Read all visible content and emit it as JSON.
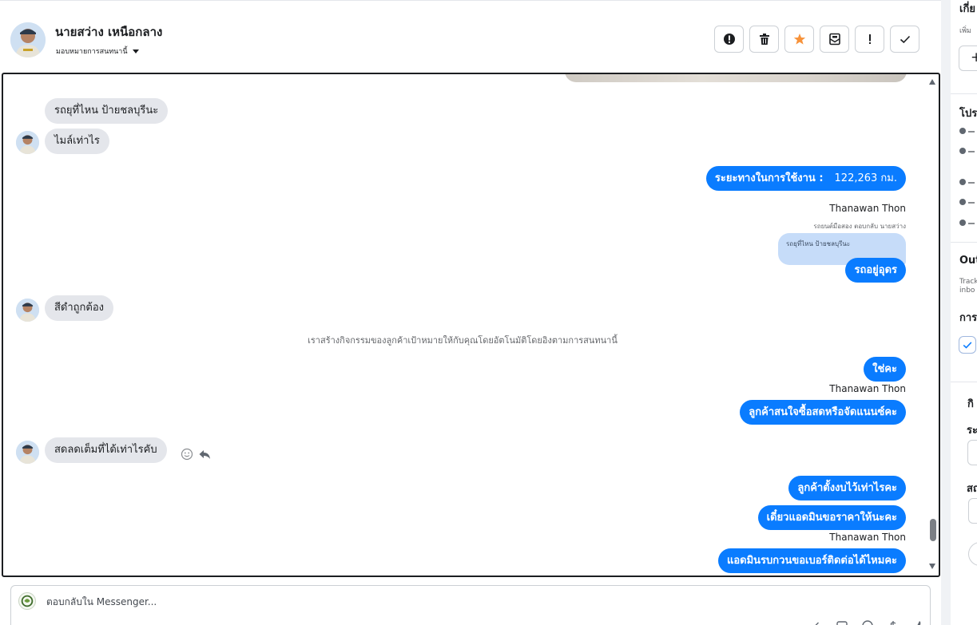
{
  "header": {
    "contact_name": "นายสว่าง เหนือกลาง",
    "assign_label": "มอบหมายการสนทนานี้",
    "tool_icons": [
      "alert-circle-icon",
      "trash-icon",
      "star-icon",
      "mark-unread-icon",
      "exclamation-icon",
      "check-icon"
    ],
    "star_color": "#f7923a"
  },
  "chat": {
    "messages": [
      {
        "dir": "in",
        "text": "รถยุที่ไหน ป้ายชลบุรีนะ"
      },
      {
        "dir": "in",
        "text": "ไมล์เท่าไร"
      },
      {
        "dir": "out",
        "text": "ระยะทางในการใช้งาน :",
        "value": "122,263 กม."
      },
      {
        "dir": "out_sender",
        "text": "Thanawan Thon"
      },
      {
        "dir": "reply_hint",
        "text": "รถยนต์มือสอง ตอบกลับ นายสว่าง"
      },
      {
        "dir": "quoted",
        "text": "รถยุที่ไหน ป้ายชลบุรีนะ"
      },
      {
        "dir": "out",
        "text": "รถอยู่อุดร"
      },
      {
        "dir": "in",
        "text": "สีดำถูกต้อง"
      },
      {
        "dir": "system",
        "text": "เราสร้างกิจกรรมของลูกค้าเป้าหมายให้กับคุณโดยอัตโนมัติโดยอิงตามการสนทนานี้"
      },
      {
        "dir": "out",
        "text": "ใช่คะ"
      },
      {
        "dir": "out_sender",
        "text": "Thanawan Thon"
      },
      {
        "dir": "out",
        "text": "ลูกค้าสนใจซื้อสดหรือจัดแนนซ์คะ"
      },
      {
        "dir": "in",
        "text": "สดลดเต็มที่ได้เท่าไรคับ"
      },
      {
        "dir": "out",
        "text": "ลูกค้าตั้งงบไว้เท่าไรคะ"
      },
      {
        "dir": "out",
        "text": "เดี๋ยวแอดมินขอราคาให้นะคะ"
      },
      {
        "dir": "out_sender",
        "text": "Thanawan Thon"
      },
      {
        "dir": "out",
        "text": "แอดมินรบกวนขอเบอร์ติดต่อได้ไหมคะ"
      }
    ],
    "outgoing_color": "#0a7cff",
    "incoming_color": "#e4e6eb"
  },
  "composer": {
    "placeholder": "ตอบกลับใน Messenger...",
    "tool_icons": [
      "attach-icon",
      "image-icon",
      "emoji-icon",
      "dollar-icon",
      "thumbs-up-icon"
    ]
  },
  "right_panel": {
    "title_1": "เกี่ย",
    "sub_1": "เพิ่ม",
    "add_symbol": "+",
    "title_2": "โปร",
    "title_3": "Out",
    "sub_3a": "Track",
    "sub_3b": "inbo",
    "title_4": "การ",
    "title_5": "กิ",
    "title_6": "ระ",
    "title_7": "สถ"
  }
}
